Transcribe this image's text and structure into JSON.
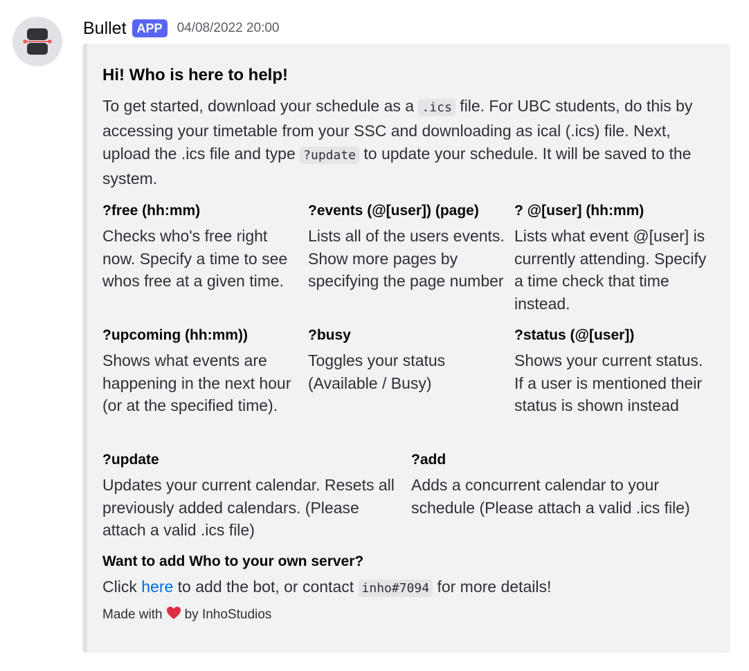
{
  "author": {
    "name": "Bullet",
    "badge": "APP",
    "timestamp": "04/08/2022 20:00",
    "avatar_icon": "bullet-avatar-icon"
  },
  "embed": {
    "title": "Hi! Who is here to help!",
    "description": {
      "part1": "To get started, download your schedule as a ",
      "code1": ".ics",
      "part2": " file. For UBC students, do this by accessing your timetable from your SSC and downloading as ical (.ics) file. Next, upload the .ics file and type ",
      "code2": "?update",
      "part3": " to update your schedule. It will be saved to the system."
    },
    "fields": [
      {
        "name": "?free (hh:mm)",
        "value": "Checks who's free right now. Specify a time to see whos free at a given time."
      },
      {
        "name": "?events (@[user]) (page)",
        "value": "Lists all of the users events. Show more pages by specifying the page number"
      },
      {
        "name": "? @[user] (hh:mm)",
        "value": "Lists what event @[user] is currently attending. Specify a time check that time instead."
      },
      {
        "name": "?upcoming (hh:mm))",
        "value": "Shows what events are happening in the next hour (or at the specified time)."
      },
      {
        "name": "?busy",
        "value": "Toggles your status (Available / Busy)"
      },
      {
        "name": "?status (@[user])",
        "value": "Shows your current status. If a user is mentioned their status is shown instead"
      },
      {
        "name": "?update",
        "value": "Updates your current calendar. Resets all previously added calendars. (Please attach a valid .ics file)"
      },
      {
        "name": "?add",
        "value": "Adds a concurrent calendar to your schedule (Please attach a valid .ics file)"
      }
    ],
    "invite": {
      "name": "Want to add Who to your own server?",
      "prefix": "Click ",
      "link_text": "here",
      "middle": " to add the bot, or contact ",
      "code": "inho#7094",
      "suffix": " for more details!"
    },
    "footer": {
      "prefix": "Made with",
      "heart": "❤️",
      "suffix": "by InhoStudios"
    }
  },
  "colors": {
    "badge": "#5865f2",
    "embed_bg": "#f1f2f4",
    "embed_bar": "#e1e2e5",
    "link": "#006ce7",
    "heart": "#dd2e44"
  }
}
